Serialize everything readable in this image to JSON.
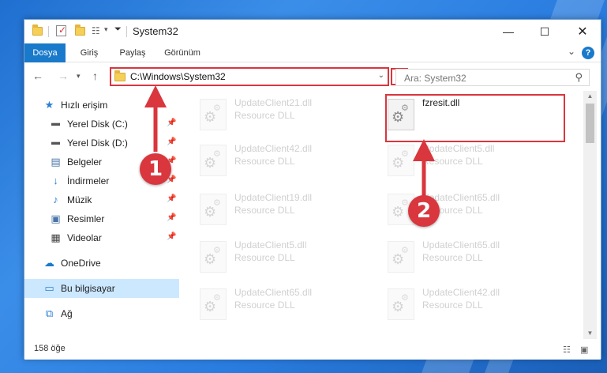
{
  "window": {
    "title": "System32"
  },
  "ribbon": {
    "tabs": [
      "Dosya",
      "Giriş",
      "Paylaş",
      "Görünüm"
    ],
    "help": "?"
  },
  "nav": {
    "address_path": "C:\\Windows\\System32",
    "search_placeholder": "Ara: System32"
  },
  "sidebar": {
    "items": [
      {
        "label": "Hızlı erişim",
        "icon": "star-icon",
        "pinned": false
      },
      {
        "label": "Yerel Disk (C:)",
        "icon": "drive-icon",
        "pinned": true
      },
      {
        "label": "Yerel Disk (D:)",
        "icon": "drive-icon",
        "pinned": true
      },
      {
        "label": "Belgeler",
        "icon": "document-icon",
        "pinned": true
      },
      {
        "label": "İndirmeler",
        "icon": "download-icon",
        "pinned": true
      },
      {
        "label": "Müzik",
        "icon": "music-icon",
        "pinned": true
      },
      {
        "label": "Resimler",
        "icon": "pictures-icon",
        "pinned": true
      },
      {
        "label": "Videolar",
        "icon": "video-icon",
        "pinned": true
      },
      {
        "label": "OneDrive",
        "icon": "cloud-icon",
        "pinned": false
      },
      {
        "label": "Bu bilgisayar",
        "icon": "computer-icon",
        "pinned": false,
        "selected": true
      },
      {
        "label": "Ağ",
        "icon": "network-icon",
        "pinned": false
      }
    ]
  },
  "files": [
    {
      "name": "UpdateClient21.dll",
      "type": "Resource DLL",
      "faded": true
    },
    {
      "name": "fzresit.dll",
      "type": "",
      "faded": false,
      "highlighted": true
    },
    {
      "name": "UpdateClient42.dll",
      "type": "Resource DLL",
      "faded": true
    },
    {
      "name": "UpdateClient5.dll",
      "type": "Resource DLL",
      "faded": true
    },
    {
      "name": "UpdateClient19.dll",
      "type": "Resource DLL",
      "faded": true
    },
    {
      "name": "UpdateClient65.dll",
      "type": "Resource DLL",
      "faded": true
    },
    {
      "name": "UpdateClient5.dll",
      "type": "Resource DLL",
      "faded": true
    },
    {
      "name": "UpdateClient65.dll",
      "type": "Resource DLL",
      "faded": true
    },
    {
      "name": "UpdateClient65.dll",
      "type": "Resource DLL",
      "faded": true
    },
    {
      "name": "UpdateClient42.dll",
      "type": "Resource DLL",
      "faded": true
    }
  ],
  "status": {
    "item_count": "158 öğe"
  },
  "annotations": {
    "step1": "1",
    "step2": "2"
  },
  "colors": {
    "accent": "#1979ca",
    "annotation_red": "#d9363e",
    "selected_bg": "#cce8ff"
  }
}
